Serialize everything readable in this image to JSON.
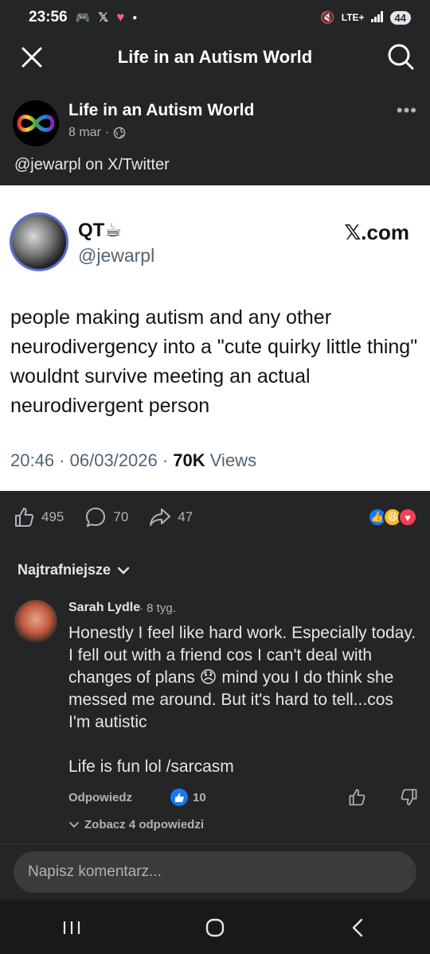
{
  "status_bar": {
    "time": "23:56",
    "network": "LTE+",
    "battery": "44"
  },
  "app_bar": {
    "title": "Life in an Autism World"
  },
  "post": {
    "page_name": "Life in an Autism World",
    "date": "8 mar",
    "caption": "@jewarpl on X/Twitter"
  },
  "tweet": {
    "name": "QT☕",
    "handle": "@jewarpl",
    "brand": "𝕏.com",
    "text": "people making autism and any other neurodivergency into a \"cute quirky little thing\" wouldnt survive meeting an actual neurodivergent person",
    "time": "20:46",
    "date": "06/03/2026",
    "views_count": "70K",
    "views_label": "Views"
  },
  "reactions": {
    "likes": "495",
    "comments": "70",
    "shares": "47"
  },
  "sort_label": "Najtrafniejsze",
  "comment": {
    "author": "Sarah Lydle",
    "time": "8 tyg.",
    "text": "Honestly I feel like hard work. Especially today. I fell out with a friend cos I can't deal with changes of plans 😞 mind you I do think she messed me around. But it's hard to tell...cos I'm autistic\n\nLife is fun lol /sarcasm",
    "reply_label": "Odpowiedz",
    "like_count": "10",
    "view_replies": "Zobacz 4 odpowiedzi"
  },
  "compose": {
    "placeholder": "Napisz komentarz..."
  },
  "colors": {
    "background": "#242526",
    "card": "#ffffff",
    "accent_blue": "#1877f2"
  }
}
